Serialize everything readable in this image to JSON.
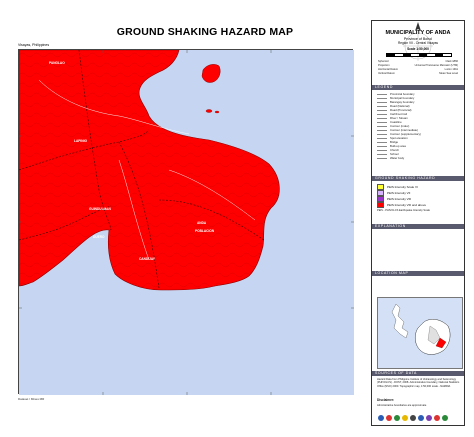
{
  "title": "GROUND SHAKING HAZARD MAP",
  "region_label": "Visayas, Philippines",
  "credit": "Dataset / Mines MR",
  "municipality": {
    "name": "MUNICIPALITY OF ANDA",
    "province": "Province of Bohol",
    "region": "Region VII - Central Visayas",
    "scale": "Scale 1:50,000"
  },
  "tech_info": [
    {
      "label": "Spheroid",
      "value": "Clark 1866"
    },
    {
      "label": "Projection",
      "value": "Universal Transverse Mercator (UTM)"
    },
    {
      "label": "Horizontal Datum",
      "value": "Luzon 1911"
    },
    {
      "label": "Vertical Datum",
      "value": "Mean Sea Level"
    }
  ],
  "sections": {
    "legend": "LEGEND",
    "hazard": "GROUND SHAKING HAZARD",
    "explanation": "EXPLANATION",
    "location": "LOCATION MAP",
    "sources": "SOURCES OF DATA"
  },
  "legend_items": [
    "Provincial boundary",
    "Municipal boundary",
    "Barangay boundary",
    "Road (National)",
    "Road (Provincial)",
    "Cart/Foot trail",
    "River / Stream",
    "Coastline",
    "Contour (index)",
    "Contour (intermediate)",
    "Contour (supplementary)",
    "Spot elevation",
    "Bridge",
    "Built-up area",
    "Church",
    "School",
    "Water body"
  ],
  "hazard_items": [
    {
      "label": "PEIS Intensity Scale VI",
      "color": "#ffff33"
    },
    {
      "label": "PEIS Intensity VII",
      "color": "#d7b3ff"
    },
    {
      "label": "PEIS Intensity VIII",
      "color": "#9933cc"
    },
    {
      "label": "PEIS Intensity VIII and above",
      "color": "#ff0000"
    }
  ],
  "hazard_note": "PEIS - PHIVOLCS Earthquake Intensity Scale",
  "sources_text": "Hazard Data from Philippine Institute of Volcanology and Seismology (PHIVOLCS) - DOST, 2008. Administrative boundary, National Statistics Office (NSO) 2000. Topographic map, 1:50,000 scale - NAMRIA",
  "disclaimer_title": "Disclaimer:",
  "disclaimer_text": "Administrative boundaries are approximate",
  "map_labels": [
    {
      "text": "PANGLAO"
    },
    {
      "text": "LAPINIG"
    },
    {
      "text": "GUINDULMAN"
    },
    {
      "text": "DUERO"
    },
    {
      "text": "CANDIJAY"
    },
    {
      "text": "ANDA"
    },
    {
      "text": "POBLACION"
    }
  ]
}
